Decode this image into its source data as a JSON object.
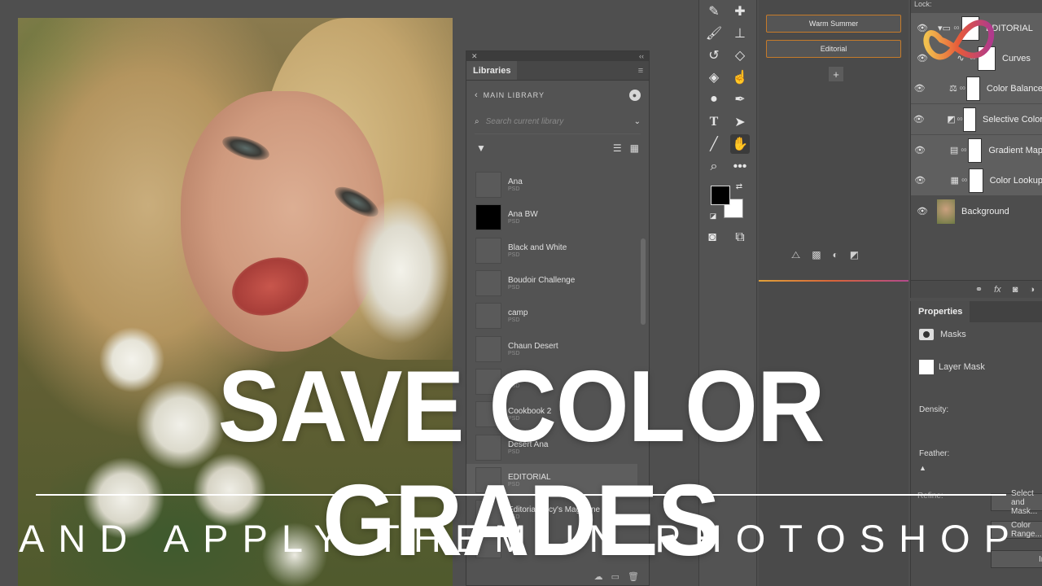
{
  "libraries": {
    "tab_label": "Libraries",
    "nav_label": "MAIN LIBRARY",
    "search_placeholder": "Search current library",
    "items": [
      {
        "name": "Ana",
        "type": "PSD"
      },
      {
        "name": "Ana BW",
        "type": "PSD"
      },
      {
        "name": "Black and White",
        "type": "PSD"
      },
      {
        "name": "Boudoir Challenge",
        "type": "PSD"
      },
      {
        "name": "camp",
        "type": "PSD"
      },
      {
        "name": "Chaun Desert",
        "type": "PSD"
      },
      {
        "name": "Cookbook",
        "type": "PSD"
      },
      {
        "name": "Cookbook 2",
        "type": "PSD"
      },
      {
        "name": "Desert Ana",
        "type": "PSD"
      },
      {
        "name": "EDITORIAL",
        "type": "PSD"
      },
      {
        "name": "Editorial Lucy's Magazine",
        "type": "PSD"
      },
      {
        "name": "",
        "type": ""
      }
    ]
  },
  "presets": {
    "buttons": [
      "Warm Summer",
      "Editorial"
    ],
    "add_label": "+"
  },
  "layers": {
    "lock_label": "Lock:",
    "items": [
      {
        "name": "EDITORIAL"
      },
      {
        "name": "Curves"
      },
      {
        "name": "Color Balance"
      },
      {
        "name": "Selective Color"
      },
      {
        "name": "Gradient Map"
      },
      {
        "name": "Color Lookup"
      },
      {
        "name": "Background"
      }
    ]
  },
  "properties": {
    "tab_label": "Properties",
    "masks_label": "Masks",
    "layer_mask_label": "Layer Mask",
    "density_label": "Density:",
    "feather_label": "Feather:",
    "refine_label": "Refine:",
    "select_btn": "Select and Mask...",
    "color_btn": "Color Range...",
    "invert_btn": "Invert"
  },
  "overlay": {
    "headline": "SAVE COLOR GRADES",
    "subline": "AND APPLY THEM IN PHOTOSHOP"
  },
  "colors": {
    "accent_orange": "#c67b2a",
    "panel_bg": "#535353"
  }
}
